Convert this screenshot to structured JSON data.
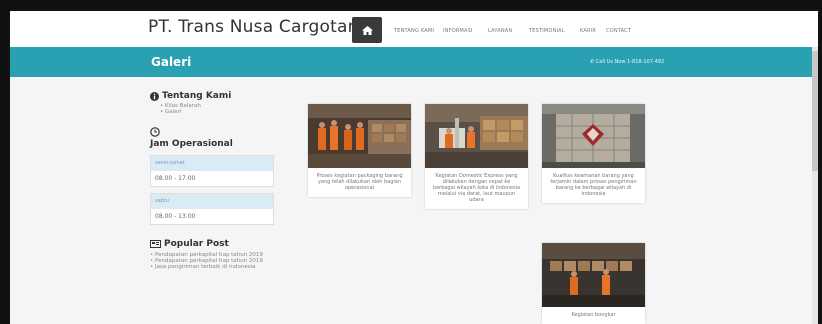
{
  "header": {
    "brand": "PT. Trans Nusa Cargotama",
    "nav": [
      "TENTANG KAMI",
      "INFORMASI",
      "LAYANAN",
      "TESTIMONIAL",
      "KARIR",
      "CONTACT"
    ]
  },
  "banner": {
    "title": "Galeri",
    "call": "Call Us Now 1-818-107-492"
  },
  "sidebar": {
    "about_title": "Tentang Kami",
    "about_items": [
      "Kilas Balarah",
      "Galeri"
    ],
    "hours_title": "Jam Operasional",
    "hours": [
      {
        "day": "senin-jumat",
        "time": "08.00 - 17.00"
      },
      {
        "day": "sabtu",
        "time": "08.00 - 13.00"
      }
    ],
    "popular_title": "Popular Post",
    "popular_items": [
      "Pendapatan perkapital tiap tahun 2019",
      "Pendapatan perkapital tiap tahun 2019",
      "Jasa pengiriman terbaik di indonesia"
    ]
  },
  "gallery": [
    {
      "caption": "Proses kegiatan packaging barang yang telah dilakukan oleh bagian operasional"
    },
    {
      "caption": "Kegiatan Domestic Express yang dilakukan dengan cepat ke berbagai wilayah kota di Indonesia melalui via darat, laut maupun udara"
    },
    {
      "caption": "Kualitas keamanan barang yang terjamin dalam proses pengiriman barang ke berbagai wilayah di indonesia"
    },
    {
      "caption": "Kegiatan bongkar"
    }
  ],
  "colors": {
    "accent": "#2aa0b3",
    "home_button": "#3a3a3a"
  },
  "icons": [
    "home-icon",
    "info-icon",
    "clock-icon",
    "popular-post-icon"
  ]
}
